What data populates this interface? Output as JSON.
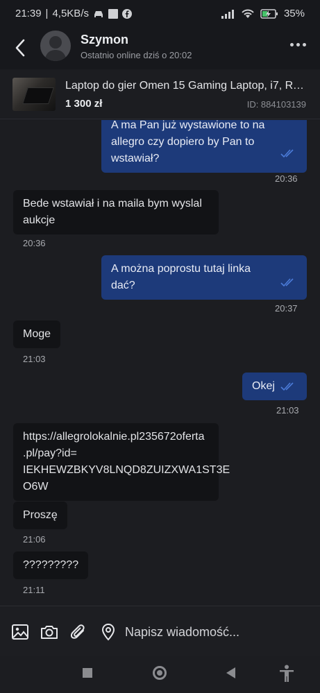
{
  "status_bar": {
    "time": "21:39",
    "speed": "4,5KB/s",
    "battery": "35"
  },
  "header": {
    "name": "Szymon",
    "status": "Ostatnio online dziś o 20:02"
  },
  "product": {
    "title": "Laptop do gier Omen 15 Gaming Laptop, i7, RT...",
    "price": "1 300 zł",
    "id": "ID: 884103139"
  },
  "messages": [
    {
      "dir": "out",
      "lines": [
        "A ma Pan już wystawione to na",
        "allegro czy dopiero  by Pan to",
        "wstawiał?"
      ],
      "time": "20:36"
    },
    {
      "dir": "in",
      "lines": [
        "Bede wstawiał i na maila bym wyslal",
        "aukcje"
      ],
      "time": "20:36"
    },
    {
      "dir": "out",
      "lines": [
        "A można poprostu tutaj linka",
        "dać?"
      ],
      "time": "20:37"
    },
    {
      "dir": "in",
      "lines": [
        "Moge"
      ],
      "time": "21:03"
    },
    {
      "dir": "out",
      "lines": [
        "Okej"
      ],
      "time": "21:03"
    },
    {
      "dir": "in",
      "lines": [
        "https://allegrolokalnie.pl235672oferta",
        ".pl/pay?id=",
        "IEKHEWZBKYV8LNQD8ZUIZXWA1ST3E",
        "O6W"
      ],
      "time": ""
    },
    {
      "dir": "in",
      "lines": [
        "Proszę"
      ],
      "time": "21:06"
    },
    {
      "dir": "in",
      "lines": [
        "?????????"
      ],
      "time": "21:11"
    }
  ],
  "input": {
    "placeholder": "Napisz wiadomość..."
  },
  "colors": {
    "outgoing": "#1d3a7a",
    "incoming": "#121316",
    "tick": "#4b7bd8"
  }
}
